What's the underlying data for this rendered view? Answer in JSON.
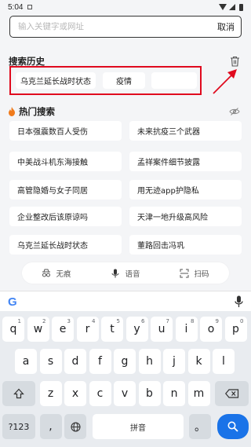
{
  "status_bar": {
    "time": "5:04"
  },
  "search": {
    "placeholder": "输入关键字或网址",
    "value": "",
    "cancel_label": "取消"
  },
  "history": {
    "title": "搜索历史",
    "items": [
      "乌克兰延长战时状态",
      "疫情",
      ""
    ]
  },
  "hot": {
    "title": "热门搜索",
    "items": [
      "日本强震数百人受伤",
      "未来抗疫三个武器",
      "中美战斗机东海接触",
      "孟祥案件细节披露",
      "高管隐婚与女子同居",
      "用无迹app护隐私",
      "企业整改后该原谅吗",
      "天津一地升级高风险",
      "乌克兰延长战时状态",
      "董路回击冯巩"
    ]
  },
  "toolbar": {
    "incognito_label": "无痕",
    "voice_label": "语音",
    "scan_label": "扫码"
  },
  "keyboard": {
    "row1": [
      "q",
      "w",
      "e",
      "r",
      "t",
      "y",
      "u",
      "i",
      "o",
      "p"
    ],
    "row1_hints": [
      "1",
      "2",
      "3",
      "4",
      "5",
      "6",
      "7",
      "8",
      "9",
      "0"
    ],
    "row2": [
      "a",
      "s",
      "d",
      "f",
      "g",
      "h",
      "j",
      "k",
      "l"
    ],
    "row3": [
      "z",
      "x",
      "c",
      "v",
      "b",
      "n",
      "m"
    ],
    "symbols_label": "?123",
    "comma_label": ",",
    "space_label": "拼音",
    "period_label": "。"
  },
  "colors": {
    "annotation": "#e00a1e",
    "accent": "#1a73e8",
    "fire": "#f07b1c"
  }
}
